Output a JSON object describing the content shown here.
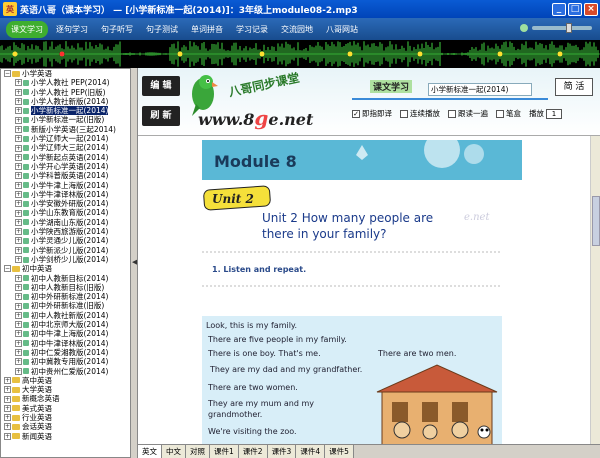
{
  "window": {
    "title": "英语八哥（课本学习） — [小学新标准一起(2014)]：3年级上module08-2.mp3"
  },
  "menu": {
    "items": [
      "课文学习",
      "逐句学习",
      "句子听写",
      "句子测试",
      "单词拼音",
      "学习记录",
      "交流园地",
      "八哥网站"
    ]
  },
  "tree": {
    "items": [
      {
        "label": "小学英语",
        "level": 0,
        "type": "folder",
        "expanded": true
      },
      {
        "label": "小学人教社 PEP(2014)",
        "level": 1
      },
      {
        "label": "小学人教社 PEP(旧版)",
        "level": 1
      },
      {
        "label": "小学人教社新版(2014)",
        "level": 1
      },
      {
        "label": "小学新标准一起(2014)",
        "level": 1,
        "selected": true
      },
      {
        "label": "小学新标准一起(旧版)",
        "level": 1
      },
      {
        "label": "新版小学英语(三起2014)",
        "level": 1
      },
      {
        "label": "小学辽师大一起(2014)",
        "level": 1
      },
      {
        "label": "小学辽师大三起(2014)",
        "level": 1
      },
      {
        "label": "小学新起点英语(2014)",
        "level": 1
      },
      {
        "label": "小学开心学英语(2014)",
        "level": 1
      },
      {
        "label": "小学科普版英语(2014)",
        "level": 1
      },
      {
        "label": "小学牛津上海版(2014)",
        "level": 1
      },
      {
        "label": "小学牛津译林版(2014)",
        "level": 1
      },
      {
        "label": "小学安徽外研版(2014)",
        "level": 1
      },
      {
        "label": "小学山东教育版(2014)",
        "level": 1
      },
      {
        "label": "小学湖南山东版(2014)",
        "level": 1
      },
      {
        "label": "小学陕西旅游版(2014)",
        "level": 1
      },
      {
        "label": "小学灵通少儿版(2014)",
        "level": 1
      },
      {
        "label": "小学新派少儿版(2014)",
        "level": 1
      },
      {
        "label": "小学剑桥少儿版(2014)",
        "level": 1
      },
      {
        "label": "初中英语",
        "level": 0,
        "type": "folder",
        "expanded": true
      },
      {
        "label": "初中人教新目标(2014)",
        "level": 1
      },
      {
        "label": "初中人教新目标(旧版)",
        "level": 1
      },
      {
        "label": "初中外研新标准(2014)",
        "level": 1
      },
      {
        "label": "初中外研新标准(旧版)",
        "level": 1
      },
      {
        "label": "初中人教社新版(2014)",
        "level": 1
      },
      {
        "label": "初中北京师大版(2014)",
        "level": 1
      },
      {
        "label": "初中牛津上海版(2014)",
        "level": 1
      },
      {
        "label": "初中牛津译林版(2014)",
        "level": 1
      },
      {
        "label": "初中仁爱湘教版(2014)",
        "level": 1
      },
      {
        "label": "初中冀教专用版(2014)",
        "level": 1
      },
      {
        "label": "初中贵州仁爱版(2014)",
        "level": 1
      },
      {
        "label": "高中英语",
        "level": 0,
        "type": "folder",
        "expanded": false
      },
      {
        "label": "大学英语",
        "level": 0,
        "type": "folder",
        "expanded": false
      },
      {
        "label": "新概念英语",
        "level": 0,
        "type": "folder",
        "expanded": false
      },
      {
        "label": "美式英语",
        "level": 0,
        "type": "folder",
        "expanded": false
      },
      {
        "label": "行业英语",
        "level": 0,
        "type": "folder",
        "expanded": false
      },
      {
        "label": "会话英语",
        "level": 0,
        "type": "folder",
        "expanded": false
      },
      {
        "label": "新闻英语",
        "level": 0,
        "type": "folder",
        "expanded": false
      }
    ]
  },
  "banner": {
    "edit_btn": "编 辑",
    "refresh_btn": "刷 新",
    "sync_title": "八哥同步课堂",
    "site_prefix": "www.8",
    "site_g": "g",
    "site_suffix": "e.net",
    "course_label": "课文学习",
    "book_select": "小学新标准一起(2014)",
    "simp_btn": "简 活",
    "opts": {
      "sentence_play": "即指即译",
      "continuous": "连续播放",
      "repeat": "跟读一遍",
      "pen": "笔盒",
      "play_label": "播放",
      "play_count": "1"
    }
  },
  "page": {
    "module": "Module 8",
    "unit": "Unit 2",
    "heading_line1": "Unit 2 How many people are",
    "heading_line2": "there in your family?",
    "watermark": "e.net",
    "exercise": "1. Listen and repeat.",
    "lines": [
      "Look, this is my family.",
      "There are five people in my family.",
      "There is one boy. That's me.",
      "There are two men.",
      "They are my dad and my grandfather.",
      "There are two women.",
      "They are my mum and my",
      "grandmother.",
      "We're visiting the zoo."
    ]
  },
  "tabs": [
    "英文",
    "中文",
    "对照",
    "课件1",
    "课件2",
    "课件3",
    "课件4",
    "课件5"
  ],
  "colors": {
    "module_band": "#5ab8d6",
    "unit_yellow": "#f5e03a",
    "illustration_bg": "#d8eef8"
  }
}
